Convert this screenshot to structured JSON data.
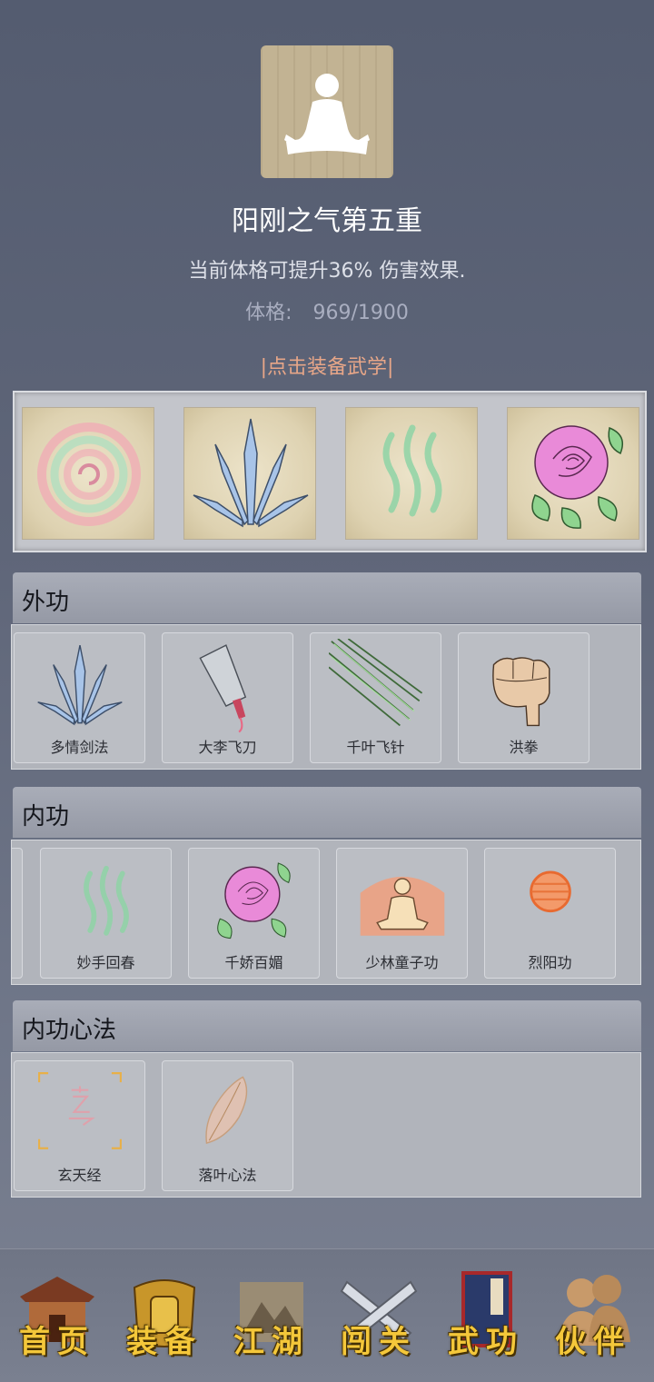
{
  "header": {
    "title": "阳刚之气第五重",
    "description": "当前体格可提升36% 伤害效果.",
    "stat_label": "体格:",
    "stat_value": "969/1900",
    "equip_link": "|点击装备武学|"
  },
  "equipped": [
    {
      "icon": "spiral-icon"
    },
    {
      "icon": "crystal-blades-icon"
    },
    {
      "icon": "green-waves-icon"
    },
    {
      "icon": "rose-icon"
    }
  ],
  "sections": {
    "outer": {
      "title": "外功",
      "skills": [
        {
          "name": "多情剑法",
          "icon": "crystal-blades-icon"
        },
        {
          "name": "大李飞刀",
          "icon": "cleaver-icon"
        },
        {
          "name": "千叶飞针",
          "icon": "needles-icon"
        },
        {
          "name": "洪拳",
          "icon": "fist-icon"
        }
      ]
    },
    "inner": {
      "title": "内功",
      "skills": [
        {
          "name": "妙手回春",
          "icon": "green-waves-icon"
        },
        {
          "name": "千娇百媚",
          "icon": "rose-icon"
        },
        {
          "name": "少林童子功",
          "icon": "meditating-monk-icon"
        },
        {
          "name": "烈阳功",
          "icon": "fire-orb-icon"
        }
      ]
    },
    "mind": {
      "title": "内功心法",
      "skills": [
        {
          "name": "玄天经",
          "icon": "xuan-seal-icon"
        },
        {
          "name": "落叶心法",
          "icon": "leaf-icon"
        }
      ]
    }
  },
  "nav": [
    {
      "label": "首页",
      "icon": "house-icon"
    },
    {
      "label": "装备",
      "icon": "armor-icon"
    },
    {
      "label": "江湖",
      "icon": "mountain-scroll-icon"
    },
    {
      "label": "闯关",
      "icon": "crossed-swords-icon"
    },
    {
      "label": "武功",
      "icon": "book-icon"
    },
    {
      "label": "伙伴",
      "icon": "partners-icon"
    }
  ]
}
